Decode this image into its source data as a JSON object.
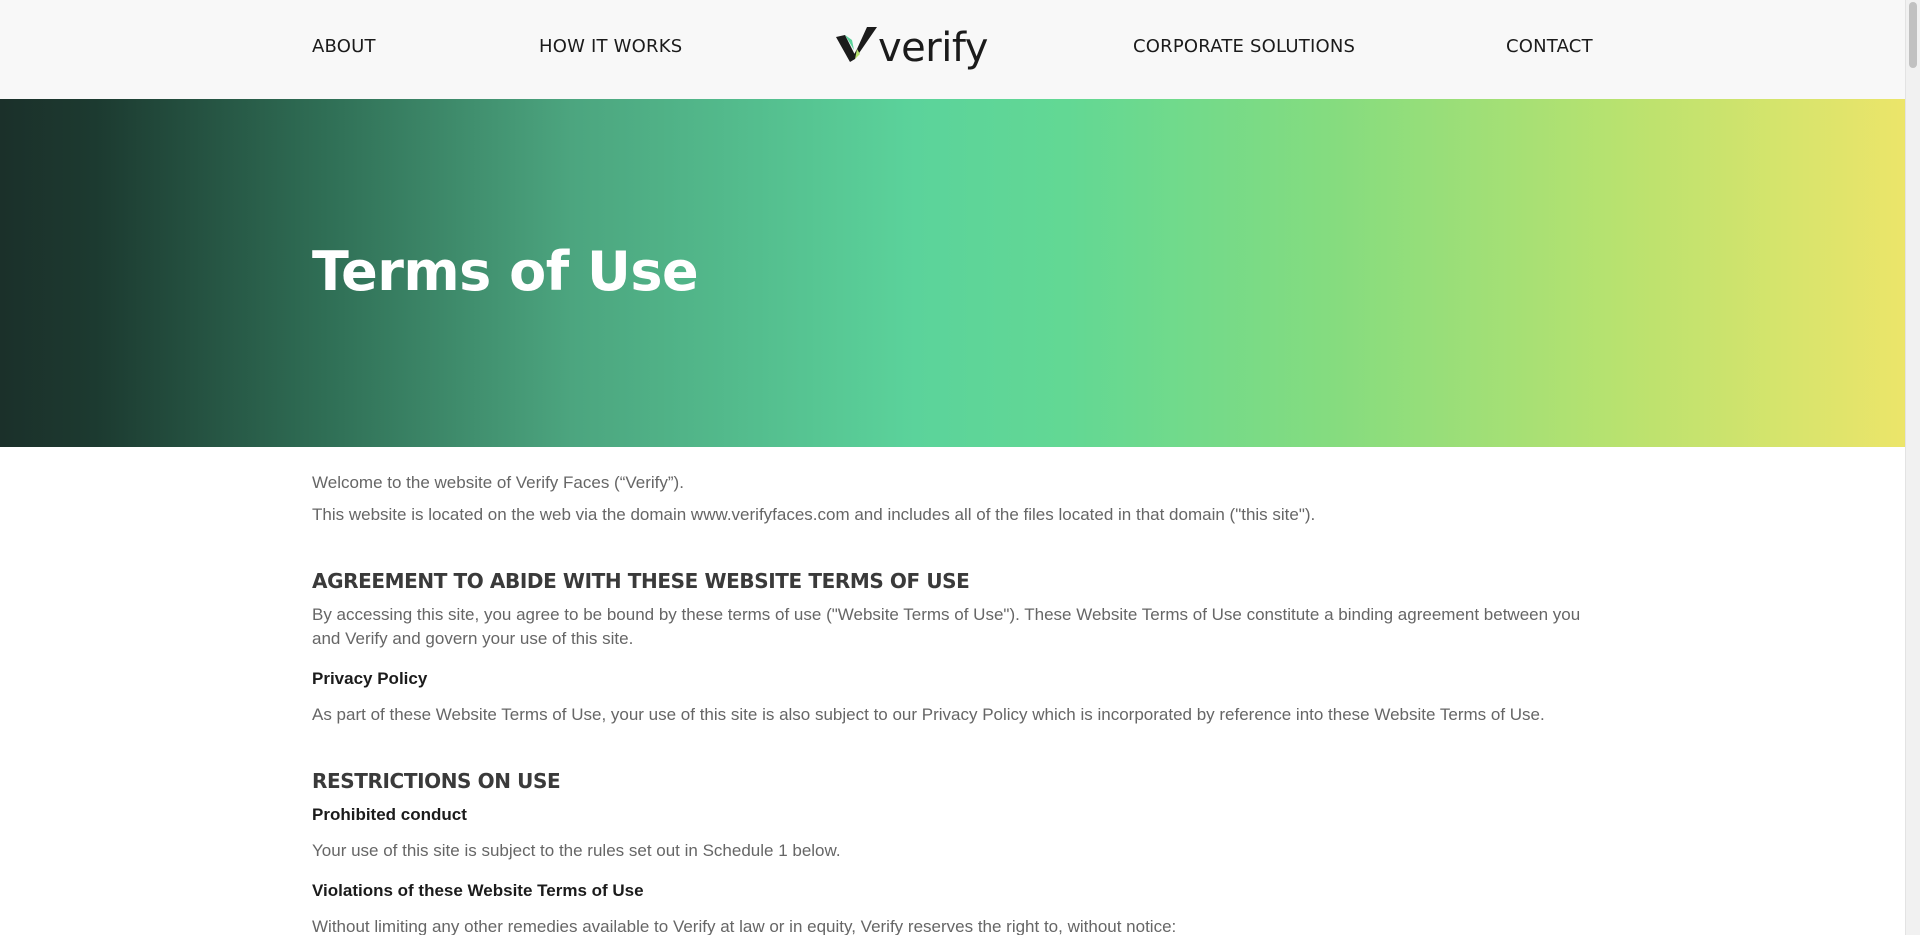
{
  "nav": {
    "about": "ABOUT",
    "how_it_works": "HOW IT WORKS",
    "corporate_solutions": "CORPORATE SOLUTIONS",
    "contact": "CONTACT"
  },
  "logo": {
    "text": "verify",
    "icon": "checkmark-logo-icon",
    "colors": {
      "dark": "#1b1b1b",
      "green": "#5bd39b",
      "yellow": "#ece56a"
    }
  },
  "hero": {
    "title": "Terms of Use",
    "gradient_colors": [
      "#1b302a",
      "#5bd39b",
      "#ece56a"
    ]
  },
  "content": {
    "welcome": "Welcome to the website of Verify Faces (“Verify”).",
    "location": "This website is located on the web via the domain www.verifyfaces.com and includes all of the files located in that domain (\"this site\").",
    "agreement_heading": "AGREEMENT TO ABIDE WITH THESE WEBSITE TERMS OF USE",
    "agreement_text": "By accessing this site, you agree to be bound by these terms of use (\"Website Terms of Use\"). These Website Terms of Use constitute a binding agreement between you and Verify and govern your use of this site.",
    "privacy_heading": "Privacy Policy",
    "privacy_text": "As part of these Website Terms of Use, your use of this site is also subject to our Privacy Policy which is incorporated by reference into these Website Terms of Use.",
    "restrictions_heading": "RESTRICTIONS ON USE",
    "prohibited_heading": "Prohibited conduct",
    "prohibited_text": "Your use of this site is subject to the rules set out in Schedule 1 below.",
    "violations_heading": "Violations of these Website Terms of Use",
    "violations_text": "Without limiting any other remedies available to Verify at law or in equity, Verify reserves the right to, without notice:"
  }
}
